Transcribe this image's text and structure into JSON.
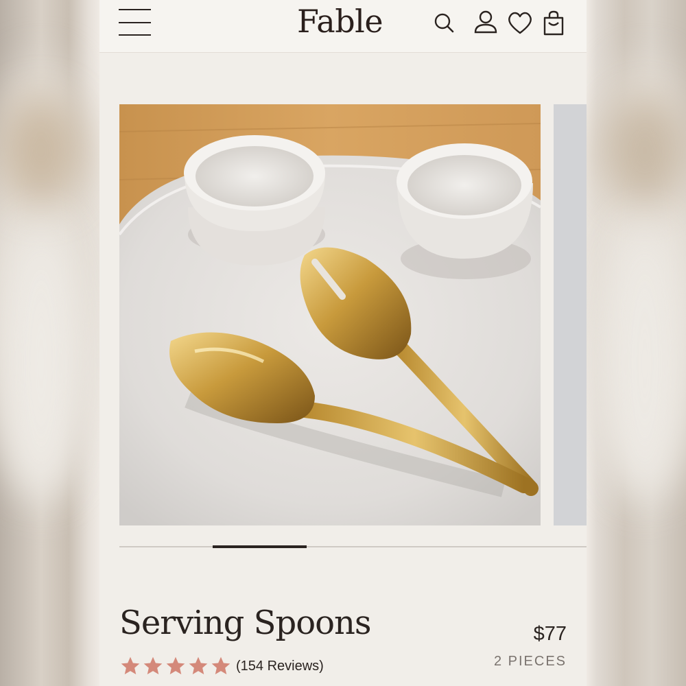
{
  "brand": {
    "name": "Fable"
  },
  "header": {
    "icons": [
      "menu-icon",
      "search-icon",
      "account-icon",
      "heart-icon",
      "cart-icon"
    ]
  },
  "product": {
    "title": "Serving Spoons",
    "price": "$77",
    "pieces": "2 PIECES",
    "rating": 5,
    "reviews": "(154 Reviews)"
  },
  "carousel": {
    "active_index": 2,
    "slide_count": 5
  },
  "colors": {
    "star": "#d4897a",
    "text": "#2a2320",
    "page_bg": "#f1eee9"
  }
}
